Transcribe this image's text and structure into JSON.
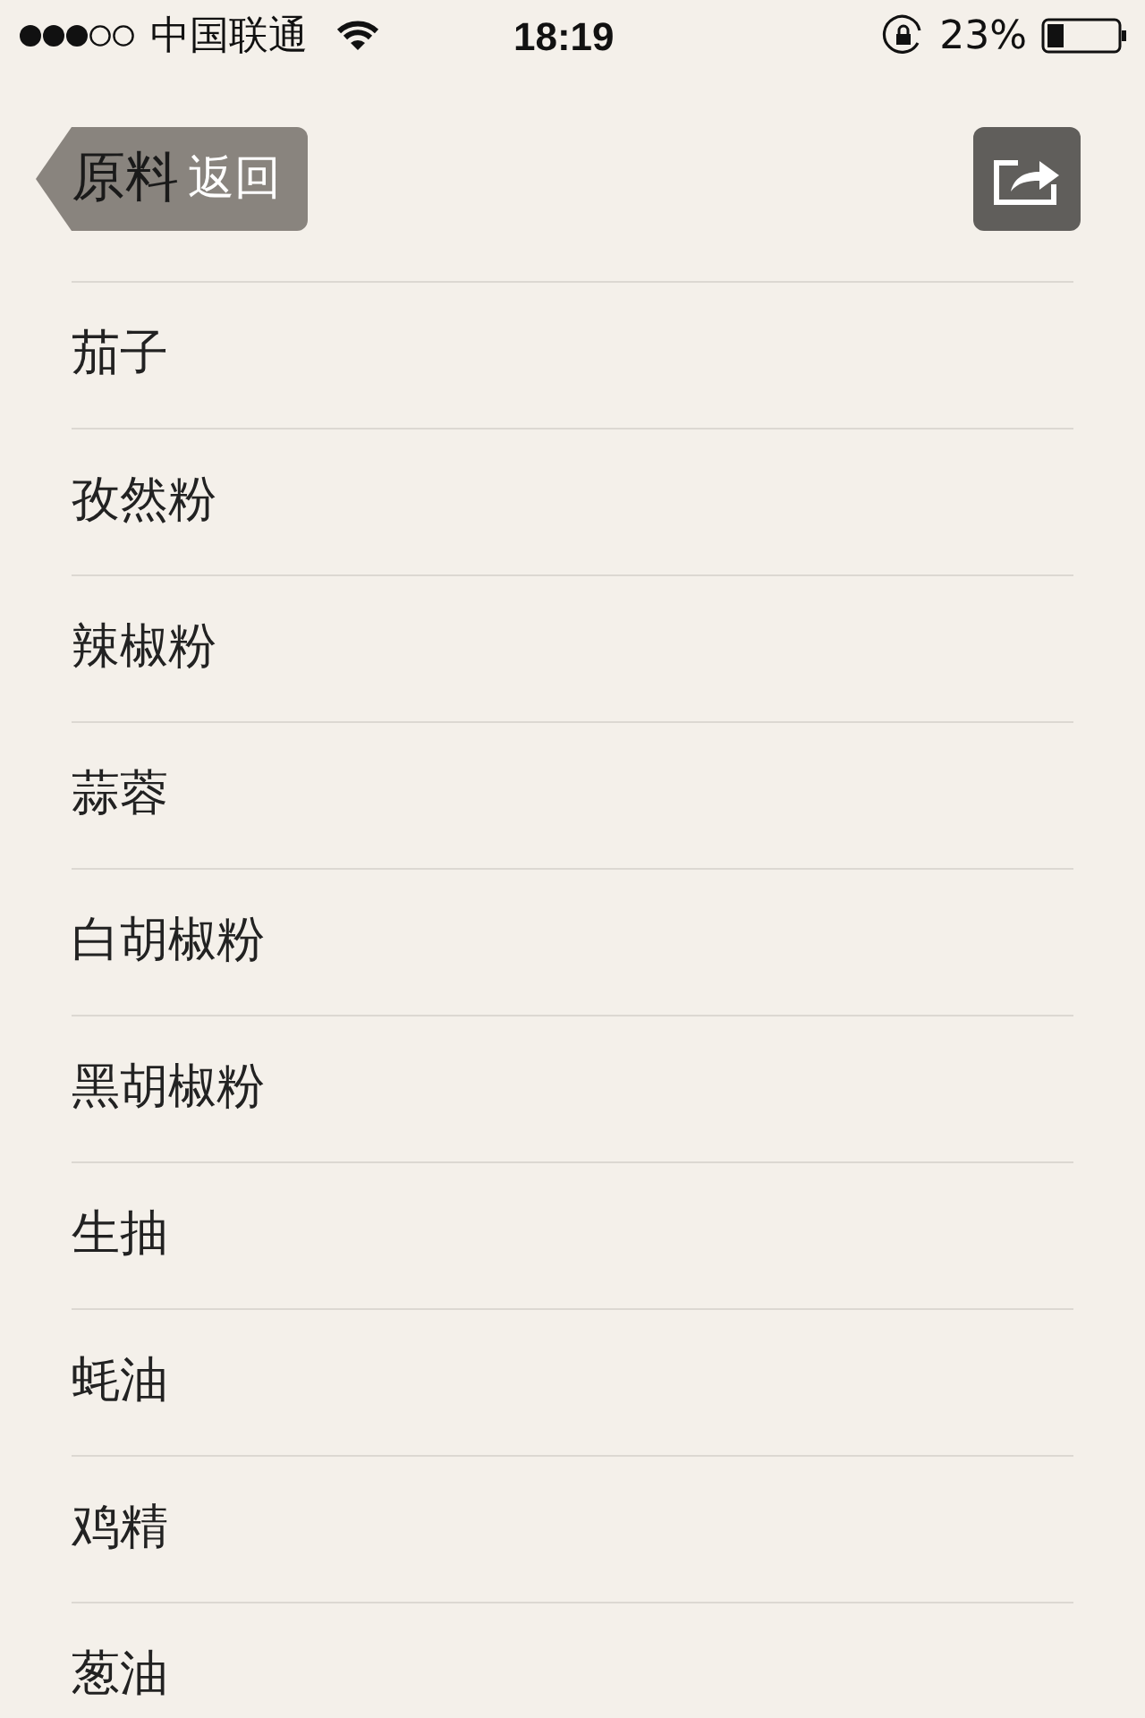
{
  "status_bar": {
    "carrier": "中国联通",
    "time": "18:19",
    "battery": "23%"
  },
  "header": {
    "title": "原料",
    "back_button": "返回"
  },
  "items": [
    {
      "label": "茄子"
    },
    {
      "label": "孜然粉"
    },
    {
      "label": "辣椒粉"
    },
    {
      "label": "蒜蓉"
    },
    {
      "label": "白胡椒粉"
    },
    {
      "label": "黑胡椒粉"
    },
    {
      "label": "生抽"
    },
    {
      "label": "蚝油"
    },
    {
      "label": "鸡精"
    },
    {
      "label": "葱油"
    }
  ]
}
